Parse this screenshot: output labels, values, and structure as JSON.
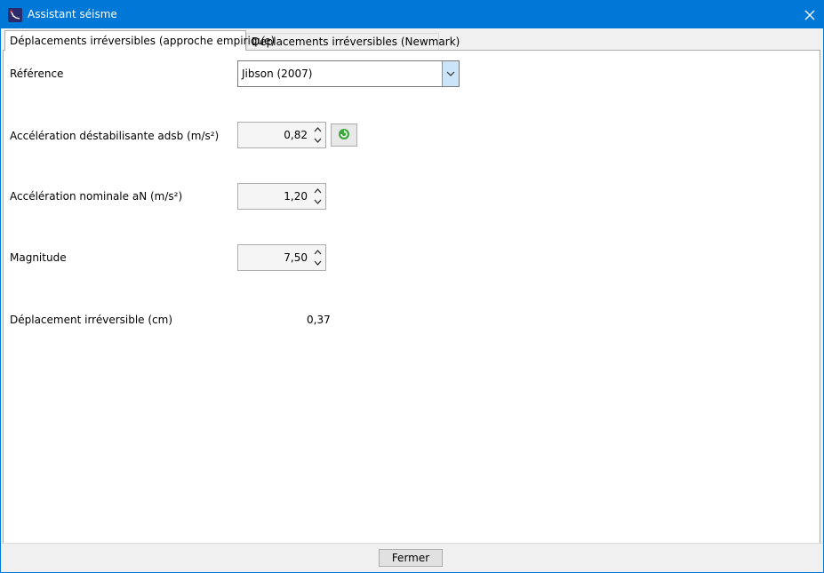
{
  "window": {
    "title": "Assistant séisme",
    "icon": "seismograph-icon"
  },
  "tabs": [
    {
      "label": "Déplacements irréversibles (approche empirique)",
      "active": true
    },
    {
      "label": "Déplacements irréversibles (Newmark)",
      "active": false
    }
  ],
  "form": {
    "reference_label": "Référence",
    "reference_value": "Jibson (2007)",
    "adsb_label": "Accélération déstabilisante adsb (m/s²)",
    "adsb_value": "0,82",
    "an_label": "Accélération nominale aN (m/s²)",
    "an_value": "1,20",
    "magnitude_label": "Magnitude",
    "magnitude_value": "7,50",
    "result_label": "Déplacement irréversible (cm)",
    "result_value": "0,37"
  },
  "footer": {
    "close_label": "Fermer"
  },
  "colors": {
    "titlebar": "#0078d7",
    "combo_button": "#cce4f7"
  }
}
